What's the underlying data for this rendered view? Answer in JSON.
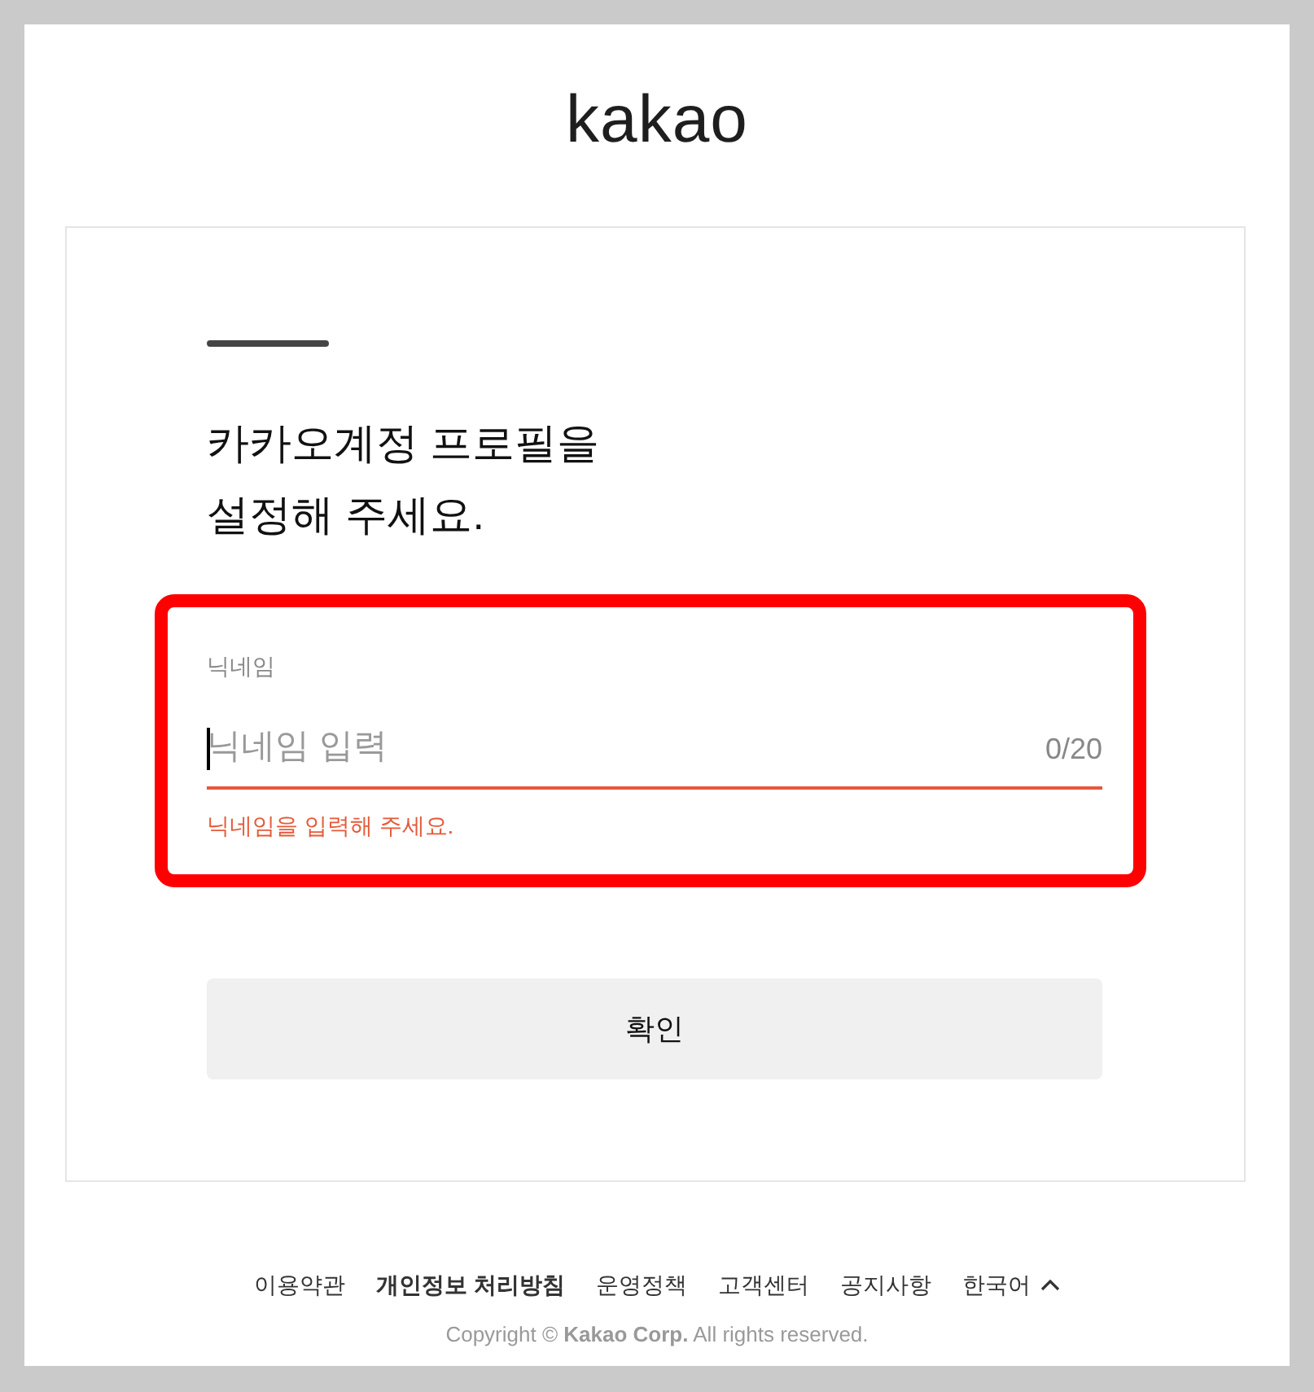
{
  "logo": "kakao",
  "card": {
    "heading": [
      "카카오계정 프로필을",
      "설정해 주세요."
    ]
  },
  "nickname_field": {
    "label": "닉네임",
    "placeholder": "닉네임 입력",
    "counter": "0/20",
    "focused": true,
    "invalid": true,
    "error": "닉네임을 입력해 주세요.",
    "highlighted": true
  },
  "confirm_button": {
    "label": "확인"
  },
  "footer": {
    "links": [
      {
        "label": "이용약관",
        "bold": false
      },
      {
        "label": "개인정보 처리방침",
        "bold": true
      },
      {
        "label": "운영정책",
        "bold": false
      },
      {
        "label": "고객센터",
        "bold": false
      },
      {
        "label": "공지사항",
        "bold": false
      }
    ],
    "language_selector": {
      "label": "한국어"
    },
    "copyright": "Copyright © **Kakao Corp.** All rights reserved."
  }
}
